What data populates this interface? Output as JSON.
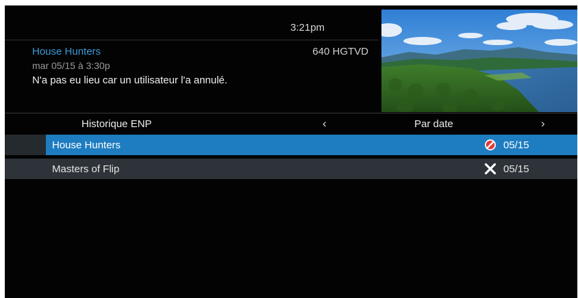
{
  "header": {
    "clock": "3:21pm",
    "program_title": "House Hunters",
    "channel": "640 HGTVD",
    "airtime": "mar 05/15 à 3:30p",
    "status_message": "N'a pas eu lieu car un utilisateur l'a annulé."
  },
  "preview": {
    "description_icon": "landscape-preview-image"
  },
  "nav": {
    "title": "Historique ENP",
    "prev_arrow": "‹",
    "sort_label": "Par date",
    "next_arrow": "›"
  },
  "rows": [
    {
      "title": "House Hunters",
      "icon": "cancelled-icon",
      "date": "05/15",
      "selected": true
    },
    {
      "title": "Masters of Flip",
      "icon": "x-icon",
      "date": "05/15",
      "selected": false
    }
  ],
  "colors": {
    "accent": "#1e7dc1",
    "title_blue": "#3b9ad8",
    "background": "#030303",
    "row_dark": "#2d3338",
    "cancel_red": "#e33b3b"
  }
}
